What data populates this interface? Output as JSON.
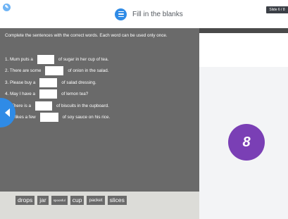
{
  "header": {
    "title": "Fill in the blanks",
    "slide_indicator": "Slide 6 / 8"
  },
  "exercise": {
    "instruction": "Complete the sentences with the correct words. Each word can be used only once.",
    "sentences": [
      {
        "before": "1. Mum puts a",
        "after": "of sugar in her cup of tea."
      },
      {
        "before": "2. There are some",
        "after": "of onion in the salad."
      },
      {
        "before": "3. Please buy a",
        "after": "of salad dressing."
      },
      {
        "before": "4. May I have a",
        "after": "of lemon tea?"
      },
      {
        "before": "There is a",
        "after": "of biscuits in the cupboard."
      },
      {
        "before": "d likes a few",
        "after": "of soy sauce on his rice."
      }
    ]
  },
  "word_bank": [
    "drops",
    "jar",
    "spoonful",
    "cup",
    "packet",
    "slices"
  ],
  "badge": {
    "number": "8",
    "color": "#7a3fb5"
  },
  "colors": {
    "accent": "#2f8be6",
    "panel": "#6a6a6a"
  },
  "icons": {
    "logo": "logo-icon",
    "title": "list-icon",
    "back": "triangle-left-icon"
  }
}
